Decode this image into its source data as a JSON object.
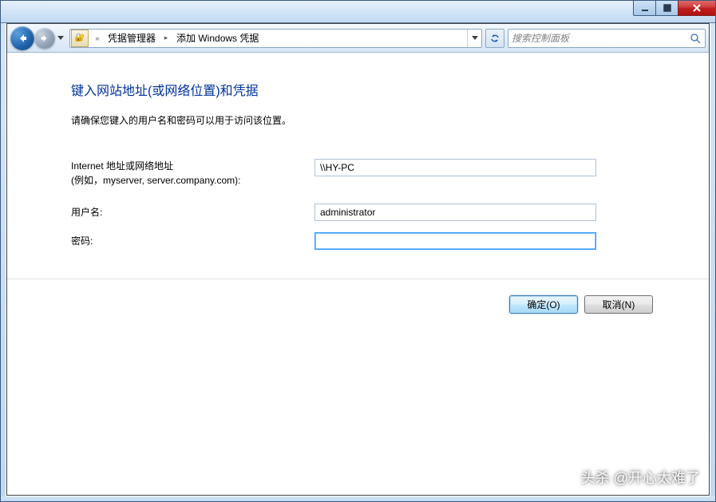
{
  "breadcrumb": {
    "items": [
      "凭据管理器",
      "添加 Windows 凭据"
    ]
  },
  "search": {
    "placeholder": "搜索控制面板"
  },
  "page": {
    "title": "键入网站地址(或网络位置)和凭据",
    "subtitle": "请确保您键入的用户名和密码可以用于访问该位置。"
  },
  "form": {
    "address_label": "Internet 地址或网络地址",
    "address_hint": "(例如，myserver, server.company.com):",
    "address_value": "\\\\HY-PC",
    "username_label": "用户名:",
    "username_value": "administrator",
    "password_label": "密码:",
    "password_value": ""
  },
  "buttons": {
    "ok": "确定(O)",
    "cancel": "取消(N)"
  },
  "watermark": "头杀 @开心太难了"
}
